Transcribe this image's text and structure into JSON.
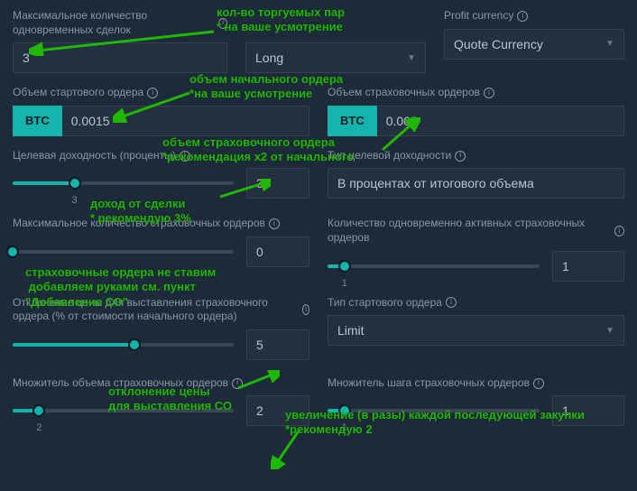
{
  "row1": {
    "max_deals_label": "Максимальное количество одновременных сделок",
    "max_deals_value": "3",
    "long_label": "Long",
    "profit_currency_label": "Profit currency",
    "profit_currency_value": "Quote Currency"
  },
  "row2": {
    "start_vol_label": "Объем стартового ордера",
    "start_vol_currency": "BTC",
    "start_vol_value": "0.0015",
    "safety_vol_label": "Объем страховочных ордеров",
    "safety_vol_currency": "BTC",
    "safety_vol_value": "0.003"
  },
  "row3": {
    "target_label": "Целевая доходность (проценты)",
    "target_value": "3",
    "target_tick": "3",
    "type_label": "Тип целевой доходности",
    "type_value": "В процентах от итогового объема"
  },
  "row4": {
    "max_safety_label": "Максимальное количество страховочных ордеров",
    "max_safety_value": "0",
    "active_safety_label": "Количество одновременно активных страховочных ордеров",
    "active_safety_value": "1",
    "active_safety_tick": "1"
  },
  "row5": {
    "deviation_label": "Отклонение цены для выставления страховочного ордера (% от стоимости начального ордера)",
    "deviation_value": "5",
    "start_type_label": "Тип стартового ордера",
    "start_type_value": "Limit"
  },
  "row6": {
    "vol_mult_label": "Множитель объема страховочных ордеров",
    "vol_mult_value": "2",
    "vol_mult_tick": "2",
    "step_mult_label": "Множитель шага страховочных ордеров",
    "step_mult_value": "1",
    "step_mult_tick": "1"
  },
  "ann": {
    "a1": "кол-во торгуемых пар\n* на ваше усмотрение",
    "a2": "объем начального ордера\n*на ваше усмотрение",
    "a3": "объем страховочного ордера\n*рекомендация х2 от начального",
    "a4": "доход от сделки\n* рекомендую 3%",
    "a5": "страховочные ордера не ставим\n добавляем руками см. пункт\n\"Добавление СО\"",
    "a6": "отклонение цены\nдля выставления СО",
    "a7": "увеличение (в разы) каждой последующей закупки\n*рекомендую 2"
  }
}
